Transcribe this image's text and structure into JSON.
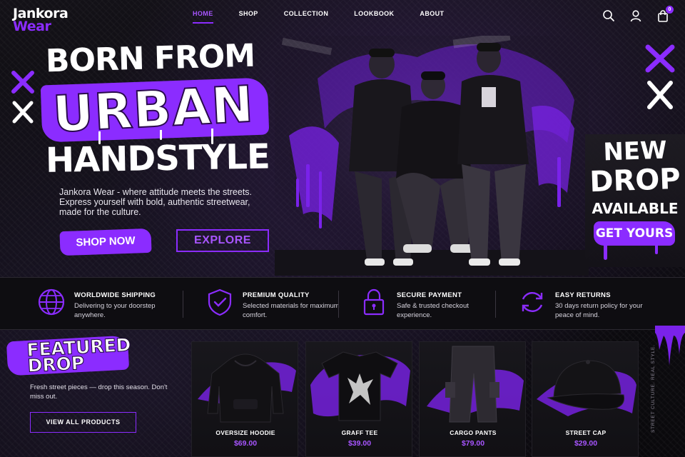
{
  "brand": {
    "line1": "Jankora",
    "line2": "Wear"
  },
  "nav": [
    {
      "label": "HOME",
      "active": true
    },
    {
      "label": "SHOP",
      "active": false
    },
    {
      "label": "COLLECTION",
      "active": false
    },
    {
      "label": "LOOKBOOK",
      "active": false
    },
    {
      "label": "ABOUT",
      "active": false
    }
  ],
  "header_icons": {
    "search": "search-icon",
    "account": "user-icon",
    "cart": "shopping-bag-icon",
    "cart_count": "0"
  },
  "hero": {
    "title_line1": "BORN FROM",
    "title_line2": "URBAN",
    "title_line3": "HANDSTYLE",
    "description": "Jankora Wear - where attitude meets the streets. Express yourself with bold, authentic streetwear, made for the culture.",
    "primary_cta": "SHOP NOW",
    "secondary_cta": "EXPLORE"
  },
  "promo": {
    "line1": "NEW",
    "line2": "DROP",
    "line3": "AVAILABLE",
    "cta": "GET YOURS"
  },
  "features": [
    {
      "icon": "globe-icon",
      "title": "WORLDWIDE SHIPPING",
      "desc": "Delivering to your doorstep anywhere."
    },
    {
      "icon": "shield-check-icon",
      "title": "PREMIUM QUALITY",
      "desc": "Selected materials for maximum comfort."
    },
    {
      "icon": "lock-icon",
      "title": "SECURE PAYMENT",
      "desc": "Safe & trusted checkout experience."
    },
    {
      "icon": "refresh-icon",
      "title": "EASY RETURNS",
      "desc": "30 days return policy for your peace of mind."
    }
  ],
  "featured": {
    "title_line1": "FEATURED",
    "title_line2": "DROP",
    "description": "Fresh street pieces — drop this season. Don't miss out.",
    "cta": "VIEW ALL PRODUCTS"
  },
  "products": [
    {
      "name": "OVERSIZE HOODIE",
      "price": "$69.00",
      "icon": "hoodie-image"
    },
    {
      "name": "GRAFF TEE",
      "price": "$39.00",
      "icon": "tshirt-image"
    },
    {
      "name": "CARGO PANTS",
      "price": "$79.00",
      "icon": "pants-image"
    },
    {
      "name": "STREET CAP",
      "price": "$29.00",
      "icon": "cap-image"
    }
  ],
  "side_text": "STREET CULTURE. REAL STYLE.",
  "colors": {
    "accent": "#8b2cff",
    "accent_text": "#a855ff",
    "background": "#0b0a0d"
  }
}
